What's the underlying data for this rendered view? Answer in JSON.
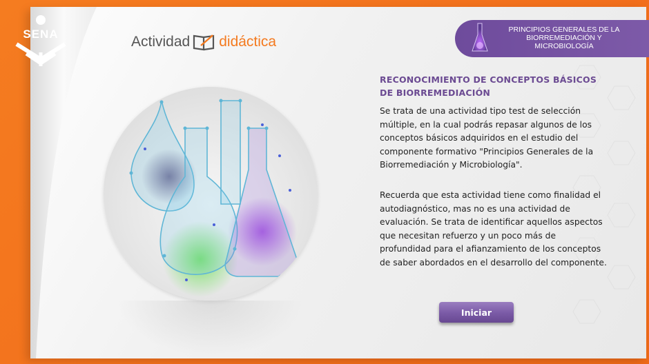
{
  "logo": {
    "text": "SENA",
    "icon": "sena-logo-icon"
  },
  "brand": {
    "word1": "Actividad",
    "word2": "didáctica",
    "icon": "book-pencil-icon"
  },
  "badge": {
    "title": "PRINCIPIOS GENERALES DE LA BIORREMEDIACIÓN Y MICROBIOLOGÍA",
    "icon": "flask-icon"
  },
  "content": {
    "heading": "RECONOCIMIENTO DE CONCEPTOS BÁSICOS DE BIORREMEDIACIÓN",
    "paragraph1": "Se trata de una actividad tipo test de selección múltiple, en la cual podrás repasar algunos de los conceptos básicos adquiridos en el estudio del componente formativo \"Principios Generales de la Biorremediación y Microbiología\".",
    "paragraph2": "Recuerda que esta actividad tiene como finalidad el autodiagnóstico, mas no es una actividad de evaluación. Se trata de identificar aquellos aspectos que necesitan refuerzo y un poco más de profundidad para el afianzamiento de los conceptos de saber abordados en el desarrollo del componente."
  },
  "actions": {
    "start_label": "Iniciar"
  },
  "colors": {
    "orange": "#f47a1f",
    "purple": "#6e4b9c",
    "heading": "#6b4a92"
  }
}
